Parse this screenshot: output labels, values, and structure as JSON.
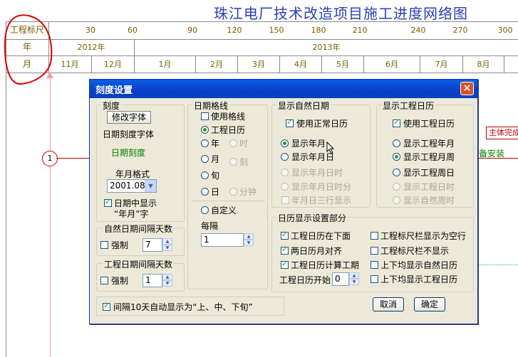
{
  "background": {
    "title": "珠江电厂技术改造项目施工进度网络图",
    "row1_label": "工程标尺",
    "row2_label": "年",
    "row3_label": "月",
    "ruler_ticks": [
      "30",
      "60",
      "90",
      "120",
      "150",
      "180",
      "210",
      "240",
      "270",
      "300"
    ],
    "years": [
      "2012年",
      "2013年"
    ],
    "months": [
      "11月",
      "12月",
      "1月",
      "2月",
      "3月",
      "4月",
      "5月",
      "6月",
      "7月",
      "8月"
    ],
    "node_number": "1",
    "right_complete_text": "主体完成",
    "right_install_text": "备安装"
  },
  "dialog": {
    "title": "刻度设置",
    "close_label": "×",
    "scale_group": {
      "label": "刻度",
      "modify_font_button": "修改字体",
      "date_font_label": "日期刻度字体",
      "date_font_sample": "日期刻度",
      "year_month_format_label": "年月格式",
      "year_month_format_value": "2001.08",
      "show_year_month_checkbox": "日期中显示",
      "show_year_month_checkbox_line2": "“年月”字"
    },
    "natural_interval": {
      "label": "自然日期间隔天数",
      "force_label": "强制",
      "value": "7"
    },
    "project_interval": {
      "label": "工程日期间隔天数",
      "force_label": "强制",
      "value": "1"
    },
    "gridline_group": {
      "label": "日期格线",
      "use_gridline": "使用格线",
      "project_calendar": "工程日历",
      "year": "年",
      "hour": "时",
      "month": "月",
      "quarter": "刻",
      "xun": "旬",
      "day": "日",
      "minute": "分钟",
      "custom": "自定义",
      "every_label": "每隔",
      "every_value": "1"
    },
    "natural_date_group": {
      "label": "显示自然日期",
      "use_normal_calendar": "使用正常日历",
      "show_year_month": "显示年月",
      "show_year_month_day": "显示年月日",
      "show_ymd_hour": "显示年月日时",
      "show_ymd_hour_minute": "显示年月日时分",
      "ymd_three_rows": "年月日三行显示"
    },
    "project_calendar_group": {
      "label": "显示工程日历",
      "use_project_calendar": "使用工程日历",
      "show_project_year_month": "显示工程年月",
      "show_project_month_week": "显示工程月周",
      "show_project_week_day": "显示工程周日",
      "show_project_day_hour": "显示工程日时",
      "show_natural_week_hour": "显示自然周时"
    },
    "calendar_display_group": {
      "label": "日历显示设置部分",
      "project_calendar_below": "工程日历在下面",
      "two_calendars_aligned": "两日历月对齐",
      "calc_duration_by_project_calendar": "工程日历计算工期",
      "project_calendar_start_label": "工程日历开始",
      "project_calendar_start_value": "0",
      "ruler_bar_blank": "工程标尺栏显示为空行",
      "ruler_bar_hidden": "工程标尺栏不显示",
      "both_natural": "上下均显示自然日历",
      "both_project": "上下均显示工程日历"
    },
    "auto_xun_checkbox": "间隔10天自动显示为“上、中、下旬”",
    "cancel_button": "取消",
    "ok_button": "确定"
  }
}
